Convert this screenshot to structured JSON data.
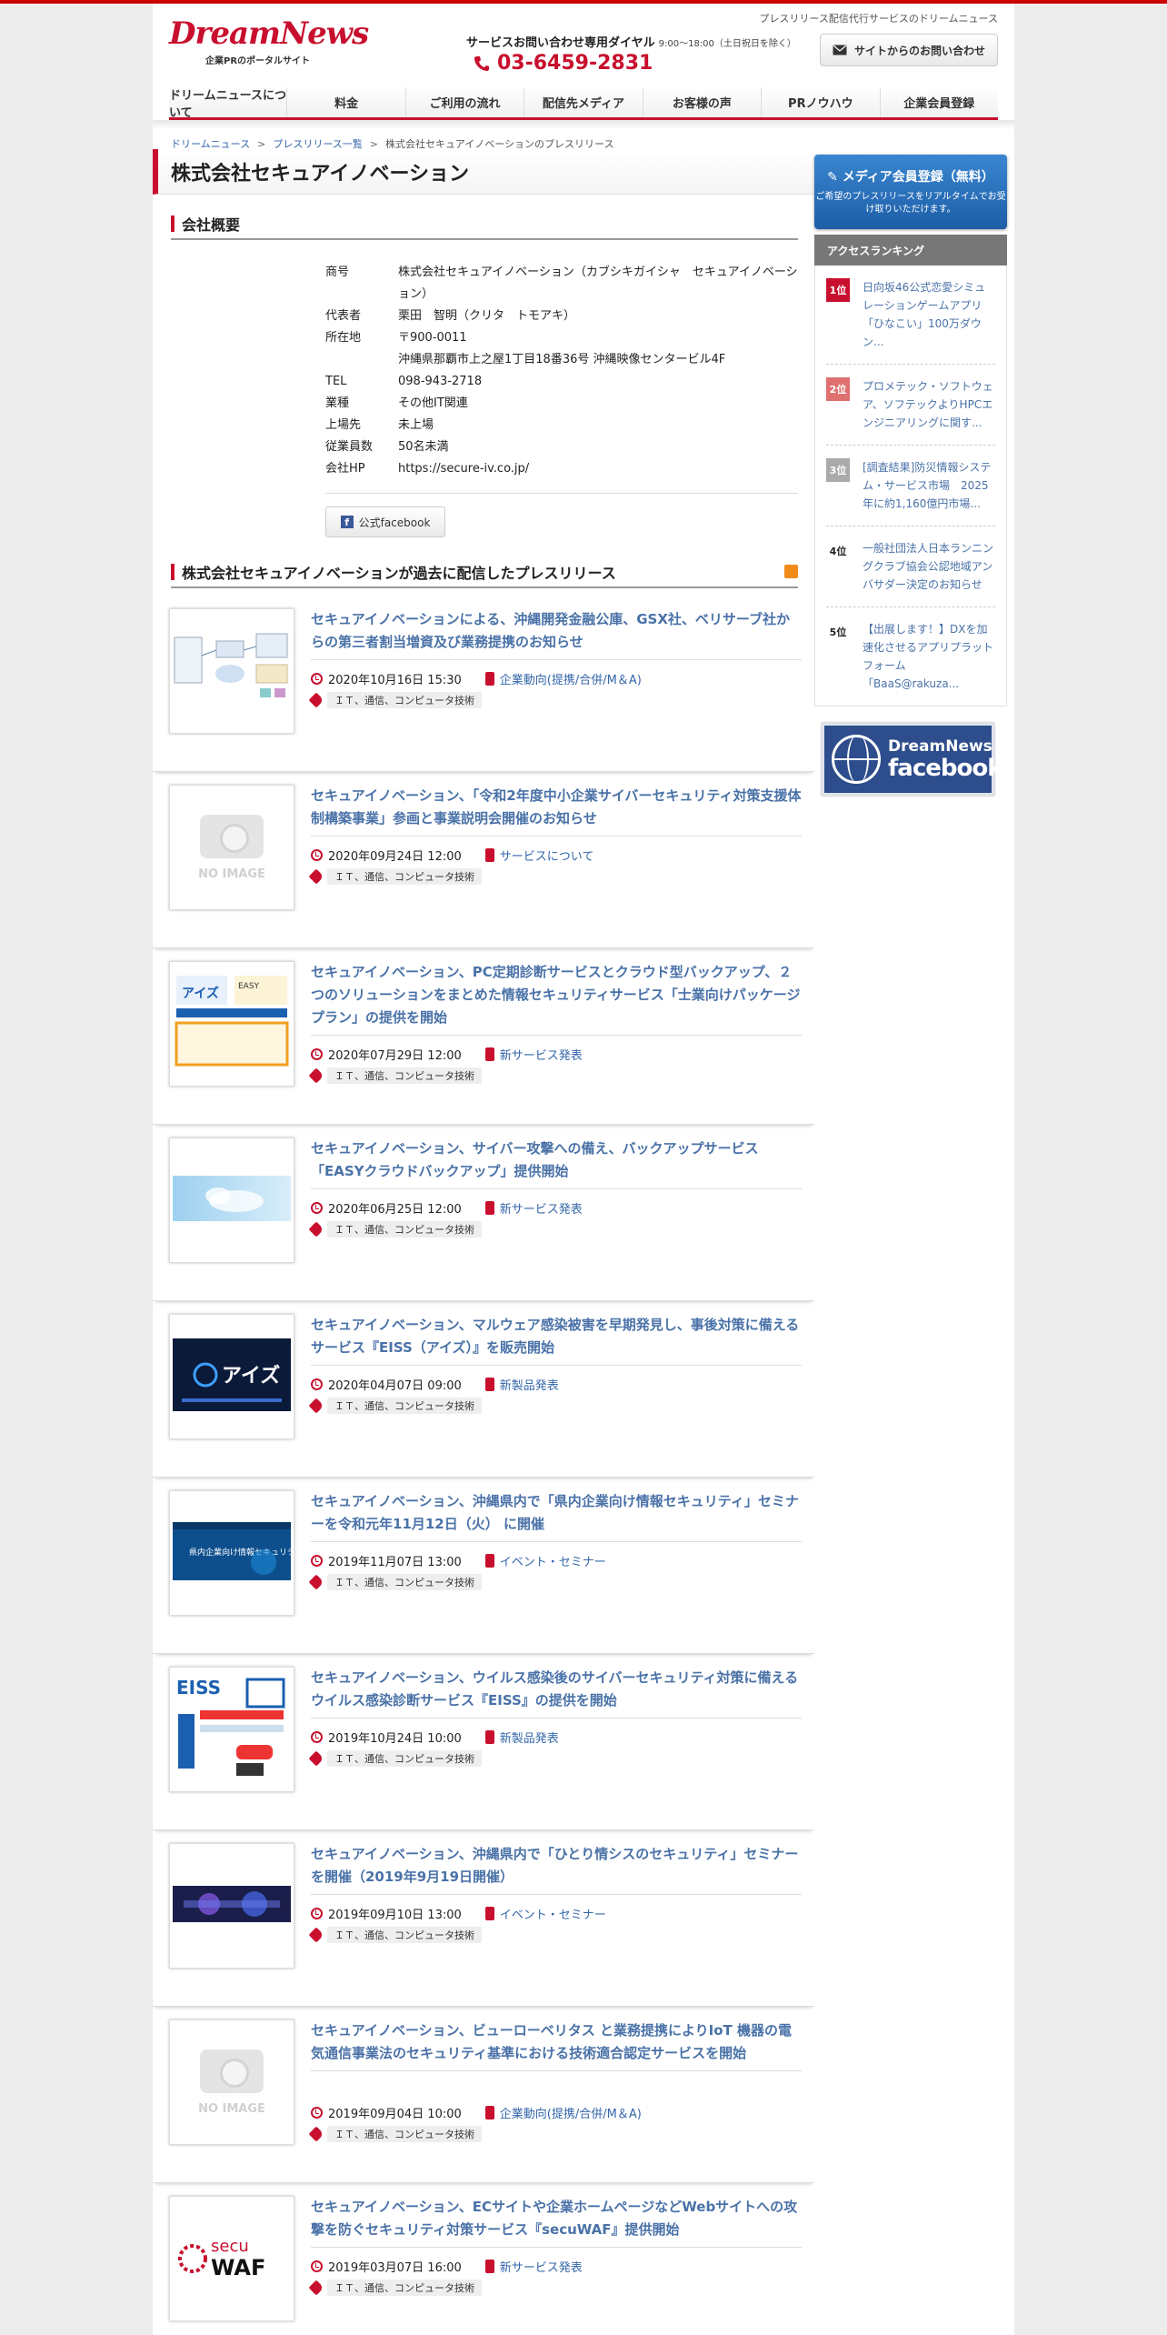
{
  "header": {
    "tagline": "プレスリリース配信代行サービスのドリームニュース",
    "logo_text": "DreamNews",
    "logo_sub": "企業PRのポータルサイト",
    "dial_label": "サービスお問い合わせ専用ダイヤル",
    "dial_hours": "9:00～18:00（土日祝日を除く）",
    "phone": "03-6459-2831",
    "contact_button": "サイトからのお問い合わせ"
  },
  "nav": [
    "ドリームニュースについて",
    "料金",
    "ご利用の流れ",
    "配信先メディア",
    "お客様の声",
    "PRノウハウ",
    "企業会員登録"
  ],
  "breadcrumb": [
    "ドリームニュース",
    "プレスリリース一覧",
    "株式会社セキュアイノベーションのプレスリリース"
  ],
  "page_title": "株式会社セキュアイノベーション",
  "company": {
    "heading": "会社概要",
    "rows": [
      {
        "k": "商号",
        "v": "株式会社セキュアイノベーション（カブシキガイシャ　セキュアイノベーション）"
      },
      {
        "k": "代表者",
        "v": "栗田　智明（クリタ　トモアキ）"
      },
      {
        "k": "所在地",
        "v": "〒900-0011"
      },
      {
        "k": "",
        "v": "沖縄県那覇市上之屋1丁目18番36号 沖縄映像センタービル4F"
      },
      {
        "k": "TEL",
        "v": "098-943-2718"
      },
      {
        "k": "業種",
        "v": "その他IT関連"
      },
      {
        "k": "上場先",
        "v": "未上場"
      },
      {
        "k": "従業員数",
        "v": "50名未満"
      },
      {
        "k": "会社HP",
        "v": "https://secure-iv.co.jp/"
      }
    ],
    "facebook_button": "公式facebook"
  },
  "press": {
    "heading": "株式会社セキュアイノベーションが過去に配信したプレスリリース",
    "no_image": "NO IMAGE",
    "items": [
      {
        "title": "セキュアイノベーションによる、沖縄開発金融公庫、GSX社、ベリサーブ社からの第三者割当増資及び業務提携のお知らせ",
        "date": "2020年10月16日 15:30",
        "category": "企業動向(提携/合併/M＆A)",
        "tag": "ＩＴ、通信、コンピュータ技術",
        "thumb": "diagram"
      },
      {
        "title": "セキュアイノベーション、「令和2年度中小企業サイバーセキュリティ対策支援体制構築事業」参画と事業説明会開催のお知らせ",
        "date": "2020年09月24日 12:00",
        "category": "サービスについて",
        "tag": "ＩＴ、通信、コンピュータ技術",
        "thumb": "none"
      },
      {
        "title": "セキュアイノベーション、PC定期診断サービスとクラウド型バックアップ、２つのソリューションをまとめた情報セキュリティサービス「士業向けパッケージプラン」の提供を開始",
        "date": "2020年07月29日 12:00",
        "category": "新サービス発表",
        "tag": "ＩＴ、通信、コンピュータ技術",
        "thumb": "package"
      },
      {
        "title": "セキュアイノベーション、サイバー攻撃への備え、バックアップサービス「EASYクラウドバックアップ」提供開始",
        "date": "2020年06月25日 12:00",
        "category": "新サービス発表",
        "tag": "ＩＴ、通信、コンピュータ技術",
        "thumb": "cloud"
      },
      {
        "title": "セキュアイノベーション、マルウェア感染被害を早期発見し、事後対策に備えるサービス『EISS（アイズ）』を販売開始",
        "date": "2020年04月07日 09:00",
        "category": "新製品発表",
        "tag": "ＩＴ、通信、コンピュータ技術",
        "thumb": "eiss"
      },
      {
        "title": "セキュアイノベーション、沖縄県内で「県内企業向け情報セキュリティ」セミナーを令和元年11月12日（火） に開催",
        "date": "2019年11月07日 13:00",
        "category": "イベント・セミナー",
        "tag": "ＩＴ、通信、コンピュータ技術",
        "thumb": "seminar"
      },
      {
        "title": "セキュアイノベーション、ウイルス感染後のサイバーセキュリティ対策に備えるウイルス感染診断サービス『EISS』の提供を開始",
        "date": "2019年10月24日 10:00",
        "category": "新製品発表",
        "tag": "ＩＴ、通信、コンピュータ技術",
        "thumb": "eiss2"
      },
      {
        "title": "セキュアイノベーション、沖縄県内で「ひとり情シスのセキュリティ」セミナーを開催（2019年9月19日開催）",
        "date": "2019年09月10日 13:00",
        "category": "イベント・セミナー",
        "tag": "ＩＴ、通信、コンピュータ技術",
        "thumb": "seminar2"
      },
      {
        "title": "セキュアイノベーション、ビューローベリタス と業務提携によりIoT 機器の電気通信事業法のセキュリティ基準における技術適合認定サービスを開始",
        "date": "2019年09月04日 10:00",
        "category": "企業動向(提携/合併/M＆A)",
        "tag": "ＩＴ、通信、コンピュータ技術",
        "thumb": "none"
      },
      {
        "title": "セキュアイノベーション、ECサイトや企業ホームページなどWebサイトへの攻撃を防ぐセキュリティ対策サービス『secuWAF』提供開始",
        "date": "2019年03月07日 16:00",
        "category": "新サービス発表",
        "tag": "ＩＴ、通信、コンピュータ技術",
        "thumb": "waf"
      }
    ]
  },
  "sidebar": {
    "member_title": "メディア会員登録（無料）",
    "member_desc": "ご希望のプレスリリースをリアルタイムでお受け取りいただけます。",
    "ranking_heading": "アクセスランキング",
    "ranking": [
      {
        "rank": "1位",
        "text": "日向坂46公式恋愛シミュレーションゲームアプリ「ひなこい」100万ダウン..."
      },
      {
        "rank": "2位",
        "text": "プロメテック・ソフトウェア、ソフテックよりHPCエンジニアリングに関す..."
      },
      {
        "rank": "3位",
        "text": "[調査結果]防災情報システム・サービス市場　2025年に約1,160億円市場..."
      },
      {
        "rank": "4位",
        "text": "一般社団法人日本ランニングクラブ協会公認地域アンバサダー決定のお知らせ"
      },
      {
        "rank": "5位",
        "text": "【出展します！】DXを加速化させるアプリプラットフォーム「BaaS@rakuza..."
      }
    ],
    "fb_banner_top": "DreamNews",
    "fb_banner_bottom": "facebook"
  },
  "colors": {
    "accent": "#c8102e",
    "link": "#4a72a8"
  }
}
